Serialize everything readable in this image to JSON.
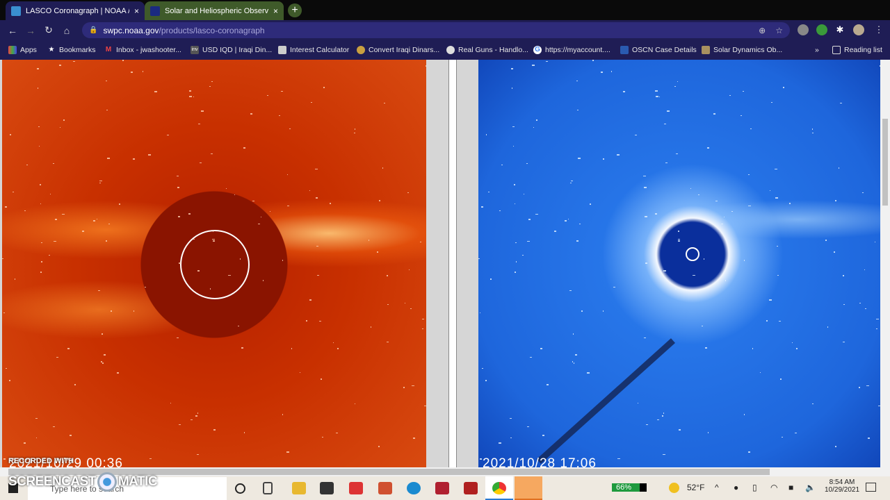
{
  "tabs": [
    {
      "title": "LASCO Coronagraph | NOAA / N",
      "active": true
    },
    {
      "title": "Solar and Heliospheric Observat",
      "active": false
    }
  ],
  "close_glyph": "×",
  "new_tab_glyph": "+",
  "address": {
    "host": "swpc.noaa.gov",
    "path": "/products/lasco-coronagraph"
  },
  "bookmarks": [
    "Apps",
    "Bookmarks",
    "Inbox - jwashooter...",
    "USD IQD | Iraqi Din...",
    "Interest Calculator",
    "Convert Iraqi Dinars...",
    "Real Guns - Handlo...",
    "https://myaccount....",
    "OSCN Case Details",
    "Solar Dynamics Ob..."
  ],
  "bookmarks_overflow": "»",
  "reading_list": "Reading list",
  "images": {
    "left_timestamp": "2021/10/29 00:36",
    "right_timestamp": "2021/10/28 17:06"
  },
  "watermark": {
    "line1": "RECORDED WITH",
    "line2": "SCREENCAST",
    "line3": "MATIC"
  },
  "taskbar": {
    "search_placeholder": "Type here to search",
    "battery": "66%",
    "weather": "52°F",
    "time": "8:54 AM",
    "date": "10/29/2021"
  }
}
